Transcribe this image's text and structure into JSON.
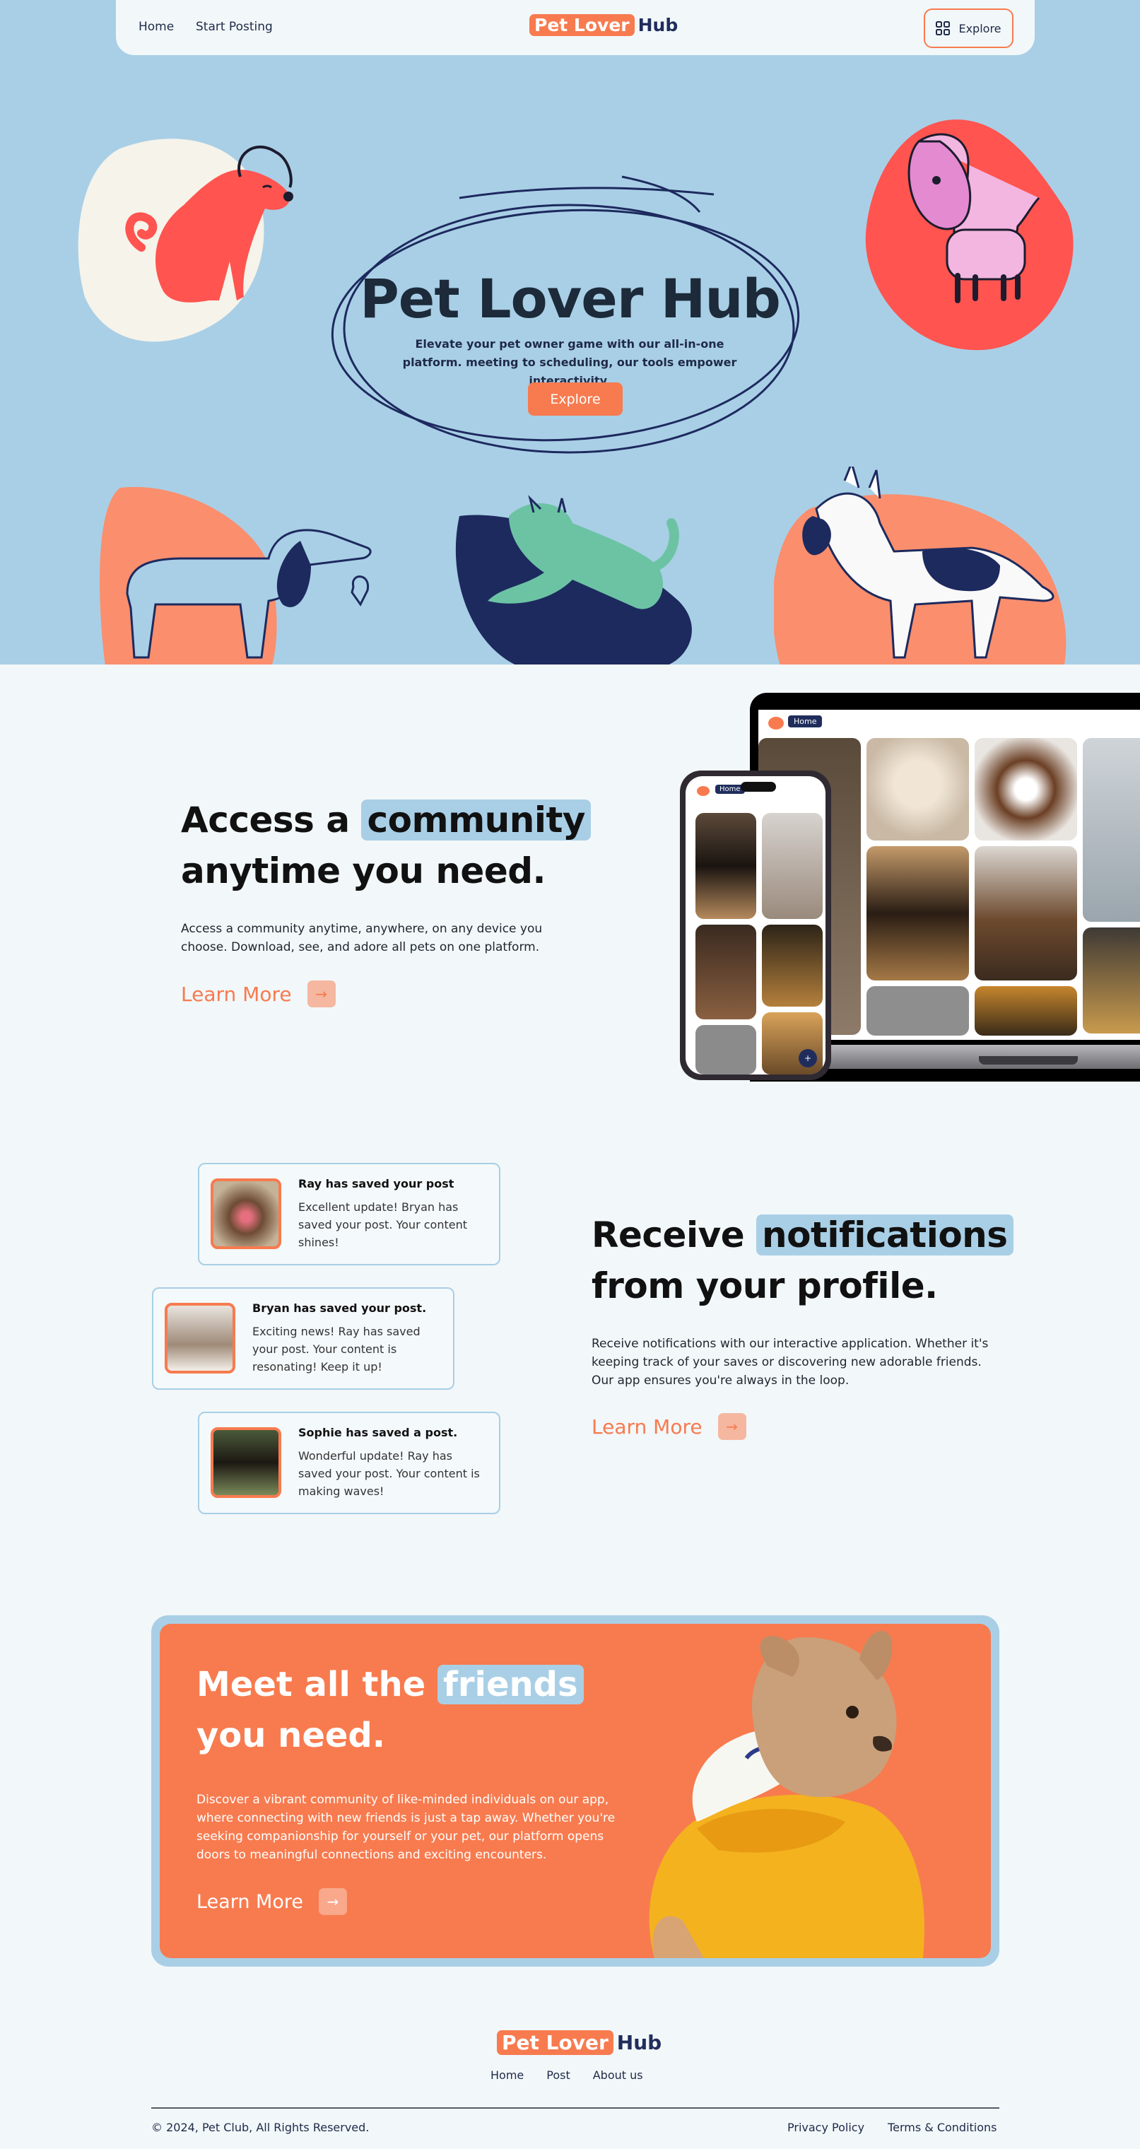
{
  "header": {
    "nav": [
      "Home",
      "Start Posting"
    ],
    "brand_part1": "Pet Lover",
    "brand_part2": "Hub",
    "explore_label": "Explore"
  },
  "hero": {
    "title": "Pet Lover Hub",
    "subtitle": "Elevate your pet owner game with our all-in-one platform. meeting to scheduling, our tools empower interactivity.",
    "button": "Explore"
  },
  "community": {
    "heading_pre": "Access a",
    "heading_hl": "community",
    "heading_post": "anytime you need.",
    "body": "Access a community anytime, anywhere, on any device you choose. Download, see, and adore all pets on one platform.",
    "learn_more": "Learn More",
    "device_home": "Home"
  },
  "notifications": {
    "heading_pre": "Receive",
    "heading_hl": "notifications",
    "heading_post": "from your profile.",
    "body": "Receive notifications with our interactive application. Whether it's keeping track of your saves or discovering new adorable friends. Our app ensures you're always in the loop.",
    "learn_more": "Learn More",
    "items": [
      {
        "title": "Ray has saved your post",
        "desc": "Excellent update! Bryan has saved your post. Your content shines!"
      },
      {
        "title": "Bryan has saved your post.",
        "desc": "Exciting news! Ray has saved your post. Your content is resonating! Keep it up!"
      },
      {
        "title": "Sophie has saved a post.",
        "desc": "Wonderful update! Ray has saved your post. Your content is making waves!"
      }
    ]
  },
  "cta": {
    "heading_pre": "Meet all the",
    "heading_hl": "friends",
    "heading_post": "you need.",
    "body": "Discover a vibrant community of like-minded individuals on our app, where connecting with new friends is just a tap away. Whether you're seeking companionship for yourself or your pet, our platform opens doors to meaningful connections and exciting encounters.",
    "learn_more": "Learn More"
  },
  "footer": {
    "brand_part1": "Pet Lover",
    "brand_part2": "Hub",
    "links": [
      "Home",
      "Post",
      "About us"
    ],
    "copyright": "© 2024, Pet Club, All Rights Reserved.",
    "legal": [
      "Privacy Policy",
      "Terms & Conditions"
    ]
  },
  "colors": {
    "accent": "#f77b4f",
    "sky": "#a9cfe6",
    "navy": "#202d5c",
    "background": "#f2f7f9"
  }
}
